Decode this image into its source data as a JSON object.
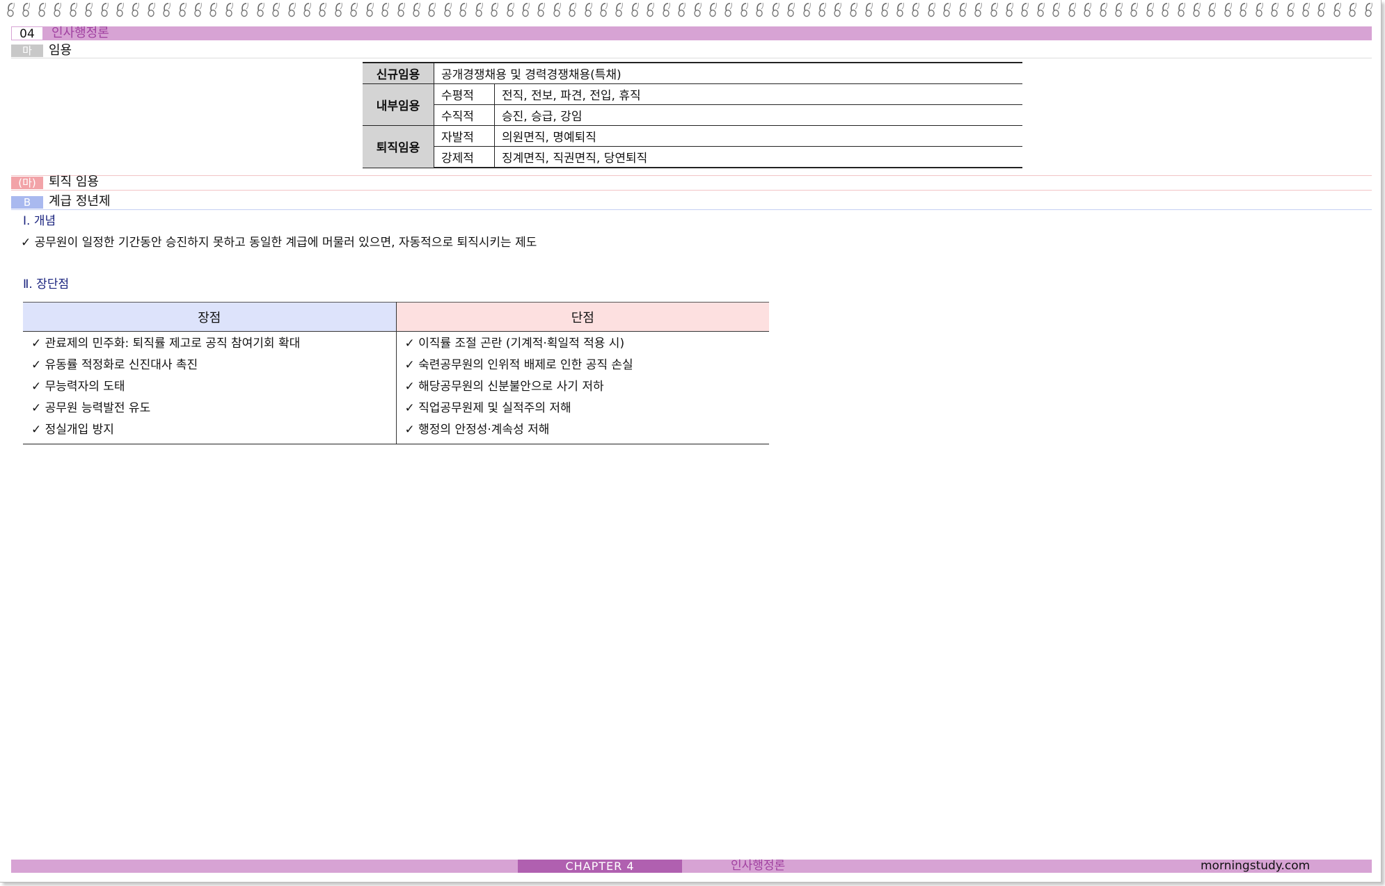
{
  "header": {
    "chapter_number": "04",
    "chapter_title": "인사행정론"
  },
  "section_ma": {
    "tag": "마",
    "title": "임용"
  },
  "appointment_table": [
    {
      "group": "신규임용",
      "rows": [
        {
          "sub": "",
          "value": "공개경쟁채용 및 경력경쟁채용(특채)"
        }
      ]
    },
    {
      "group": "내부임용",
      "rows": [
        {
          "sub": "수평적",
          "value": "전직, 전보, 파견, 전입, 휴직"
        },
        {
          "sub": "수직적",
          "value": "승진, 승급, 강임"
        }
      ]
    },
    {
      "group": "퇴직임용",
      "rows": [
        {
          "sub": "자발적",
          "value": "의원면직, 명예퇴직"
        },
        {
          "sub": "강제적",
          "value": "징계면직, 직권면직, 당연퇴직"
        }
      ]
    }
  ],
  "section_retire": {
    "tag": "(마)",
    "title": "퇴직 임용"
  },
  "section_b": {
    "tag": "B",
    "title": "계급 정년제"
  },
  "concept": {
    "heading": "Ⅰ. 개념",
    "text": "✓ 공무원이 일정한 기간동안 승진하지 못하고 동일한 계급에 머물러 있으면, 자동적으로 퇴직시키는 제도"
  },
  "pros_cons": {
    "heading": "Ⅱ. 장단점",
    "pros_header": "장점",
    "cons_header": "단점",
    "pros": [
      "✓ 관료제의 민주화: 퇴직률 제고로 공직 참여기회 확대",
      "✓ 유동률 적정화로 신진대사 촉진",
      "✓ 무능력자의 도태",
      "✓ 공무원 능력발전 유도",
      "✓ 정실개입 방지"
    ],
    "cons": [
      "✓ 이직률 조절 곤란 (기계적·획일적 적용 시)",
      "✓ 숙련공무원의 인위적 배제로 인한 공직 손실",
      "✓ 해당공무원의 신분불안으로 사기 저하",
      "✓ 직업공무원제 및 실적주의 저해",
      "✓ 행정의 안정성·계속성 저해"
    ]
  },
  "footer": {
    "chapter": "CHAPTER 4",
    "title": "인사행정론",
    "site": "morningstudy.com"
  },
  "colors": {
    "accent": "#d7a3d4",
    "accent_dark": "#b060b0",
    "pro_bg": "#dde3fb",
    "con_bg": "#fde0e0",
    "tag_b": "#a9b9ef",
    "tag_retire": "#f2a3a8"
  }
}
